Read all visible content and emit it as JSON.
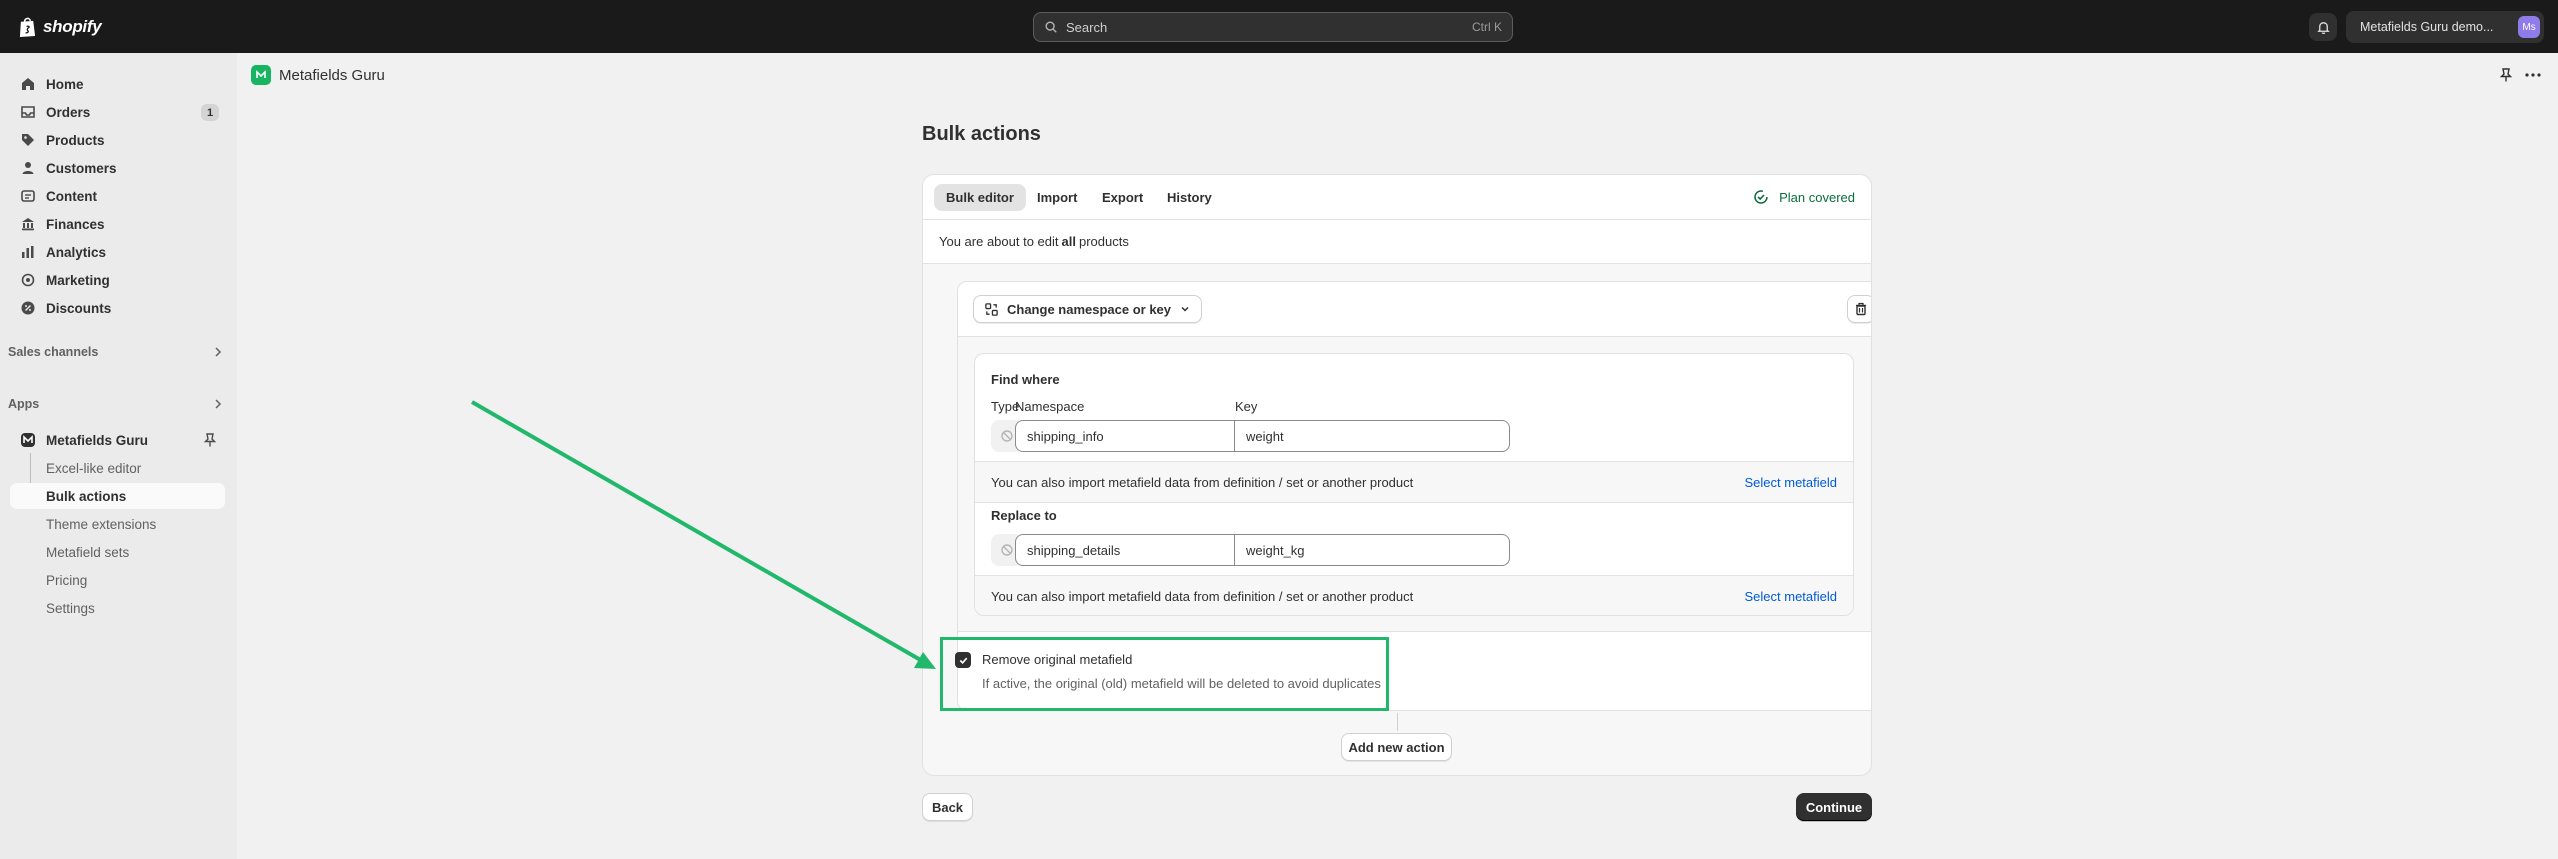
{
  "topbar": {
    "brand": "shopify",
    "search_placeholder": "Search",
    "search_shortcut": "Ctrl K",
    "store_name": "Metafields Guru demo...",
    "avatar_initials": "Ms"
  },
  "sidebar": {
    "items": [
      {
        "label": "Home",
        "icon": "home-icon"
      },
      {
        "label": "Orders",
        "icon": "orders-icon",
        "badge": "1"
      },
      {
        "label": "Products",
        "icon": "tag-icon"
      },
      {
        "label": "Customers",
        "icon": "person-icon"
      },
      {
        "label": "Content",
        "icon": "content-icon"
      },
      {
        "label": "Finances",
        "icon": "bank-icon"
      },
      {
        "label": "Analytics",
        "icon": "bar-chart-icon"
      },
      {
        "label": "Marketing",
        "icon": "target-icon"
      },
      {
        "label": "Discounts",
        "icon": "discount-icon"
      }
    ],
    "sales_channels": "Sales channels",
    "apps": "Apps",
    "app_name": "Metafields Guru",
    "app_subitems": [
      "Excel-like editor",
      "Bulk actions",
      "Theme extensions",
      "Metafield sets",
      "Pricing",
      "Settings"
    ],
    "active_subitem": "Bulk actions"
  },
  "app_header": {
    "name": "Metafields Guru"
  },
  "page": {
    "title": "Bulk actions",
    "tabs": [
      "Bulk editor",
      "Import",
      "Export",
      "History"
    ],
    "active_tab": "Bulk editor",
    "plan_status": "Plan covered",
    "info_prefix": "You are about to edit",
    "info_bold": "all",
    "info_suffix": "products"
  },
  "action": {
    "type_label": "Change namespace or key",
    "find_where": {
      "title": "Find where",
      "col_type": "Type",
      "col_namespace": "Namespace",
      "col_key": "Key",
      "namespace": "shipping_info",
      "key": "weight"
    },
    "import_hint": "You can also import metafield data from definition / set or another product",
    "select_link": "Select metafield",
    "replace_to": {
      "title": "Replace to",
      "namespace": "shipping_details",
      "key": "weight_kg"
    },
    "remove_original": {
      "label": "Remove original metafield",
      "help": "If active, the original (old) metafield will be deleted to avoid duplicates",
      "checked": true
    }
  },
  "buttons": {
    "add_new_action": "Add new action",
    "back": "Back",
    "continue": "Continue"
  },
  "colors": {
    "highlight": "#22b86b",
    "link": "#005bd3",
    "plan": "#0a6e3c",
    "primary": "#303030"
  }
}
